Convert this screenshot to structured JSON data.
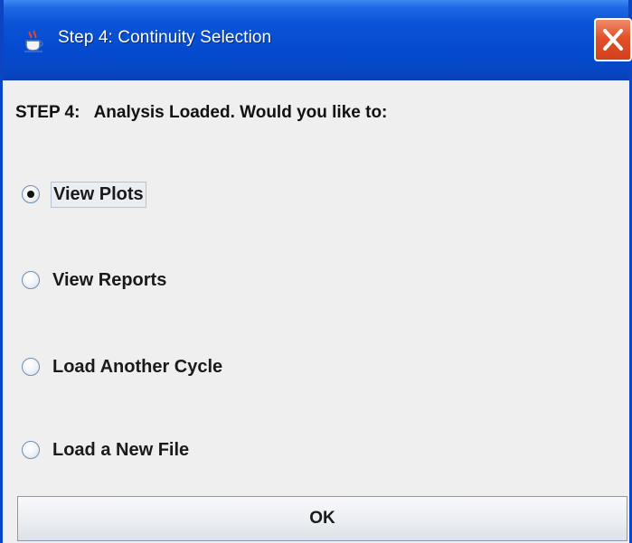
{
  "window": {
    "title": "Step 4: Continuity Selection",
    "icon": "java-cup-icon",
    "close_icon": "close-icon"
  },
  "prompt": "STEP 4:   Analysis Loaded. Would you like to:",
  "options": [
    {
      "label": "View Plots",
      "selected": true
    },
    {
      "label": "View Reports",
      "selected": false
    },
    {
      "label": "Load Another Cycle",
      "selected": false
    },
    {
      "label": "Load a New File",
      "selected": false
    }
  ],
  "ok_label": "OK",
  "colors": {
    "titlebar": "#0a53d6",
    "close_button": "#e2502a",
    "panel_bg": "#efefef"
  }
}
